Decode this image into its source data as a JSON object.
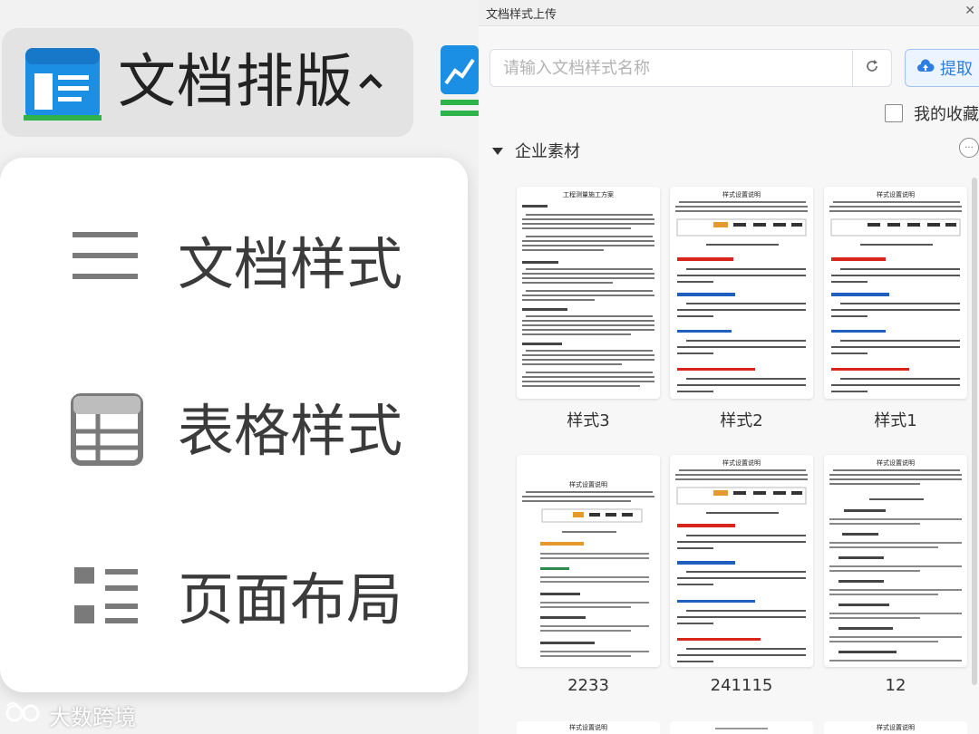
{
  "left_menu": {
    "trigger": {
      "label": "文档排版",
      "icon": "document-layout-icon",
      "caret": "caret-up-icon"
    },
    "items": [
      {
        "label": "文档样式",
        "icon": "lines-icon"
      },
      {
        "label": "表格样式",
        "icon": "table-icon"
      },
      {
        "label": "页面布局",
        "icon": "list-layout-icon"
      }
    ],
    "watermark": "大数跨境"
  },
  "dialog": {
    "title": "文档样式上传",
    "close_icon": "close-icon",
    "search": {
      "placeholder": "请输入文档样式名称",
      "value": ""
    },
    "extract_label": "提取",
    "favorites_label": "我的收藏",
    "section_title": "企业素材",
    "cards": [
      {
        "name": "样式3",
        "heading": "工程测量施工方案"
      },
      {
        "name": "样式2",
        "heading": "样式设置说明"
      },
      {
        "name": "样式1",
        "heading": "样式设置说明"
      },
      {
        "name": "2233",
        "heading": "样式设置说明"
      },
      {
        "name": "241115",
        "heading": "样式设置说明"
      },
      {
        "name": "12",
        "heading": "样式设置说明"
      }
    ],
    "peek_headings": [
      "样式设置说明",
      "样式设置说明"
    ]
  },
  "colors": {
    "accent_blue": "#2f7de1",
    "heading_red": "#d9261c",
    "heading_blue": "#1f5fbf",
    "trigger_bg": "#e3e3e3"
  }
}
